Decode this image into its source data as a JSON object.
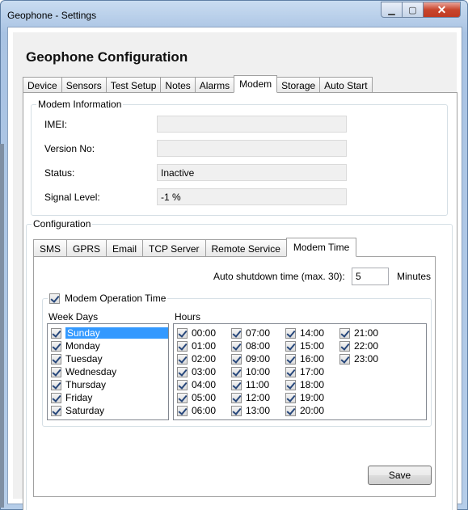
{
  "window": {
    "title": "Geophone - Settings",
    "min_label": "▁",
    "max_label": "▢",
    "close_label": "✕"
  },
  "heading": "Geophone Configuration",
  "main_tabs": [
    "Device",
    "Sensors",
    "Test Setup",
    "Notes",
    "Alarms",
    "Modem",
    "Storage",
    "Auto Start"
  ],
  "modem_info": {
    "legend": "Modem Information",
    "imei_label": "IMEI:",
    "imei_value": "",
    "version_label": "Version No:",
    "version_value": "",
    "status_label": "Status:",
    "status_value": "Inactive",
    "signal_label": "Signal Level:",
    "signal_value": "-1 %"
  },
  "configuration": {
    "legend": "Configuration",
    "tabs": [
      "SMS",
      "GPRS",
      "Email",
      "TCP Server",
      "Remote Service",
      "Modem Time"
    ],
    "auto_shutdown_label": "Auto shutdown time (max. 30):",
    "auto_shutdown_value": "5",
    "minutes_label": "Minutes",
    "operation_time_label": "Modem Operation Time",
    "week_days_label": "Week Days",
    "hours_label": "Hours",
    "days": [
      "Sunday",
      "Monday",
      "Tuesday",
      "Wednesday",
      "Thursday",
      "Friday",
      "Saturday"
    ],
    "hours": [
      "00:00",
      "01:00",
      "02:00",
      "03:00",
      "04:00",
      "05:00",
      "06:00",
      "07:00",
      "08:00",
      "09:00",
      "10:00",
      "11:00",
      "12:00",
      "13:00",
      "14:00",
      "15:00",
      "16:00",
      "17:00",
      "18:00",
      "19:00",
      "20:00",
      "21:00",
      "22:00",
      "23:00"
    ],
    "save_label": "Save"
  }
}
